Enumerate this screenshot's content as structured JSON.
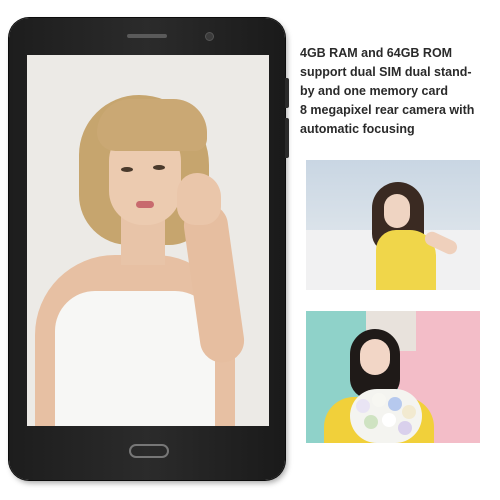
{
  "description": {
    "lines": [
      "4GB RAM and 64GB ROM",
      "support dual SIM dual stand-",
      "by and one memory card",
      "8 megapixel rear camera with",
      "automatic focusing"
    ]
  },
  "colors": {
    "tablet_body": "#222222",
    "screen_background": "#eceae6",
    "text": "#2a2a2a",
    "photo1_accent": "#f0d64a",
    "photo2_background": "#8fd2c9",
    "photo2_accent": "#f3bdc8"
  },
  "icons": {
    "front_camera": "front-camera-icon",
    "home_button": "home-button-icon",
    "speaker": "speaker-grille-icon"
  }
}
